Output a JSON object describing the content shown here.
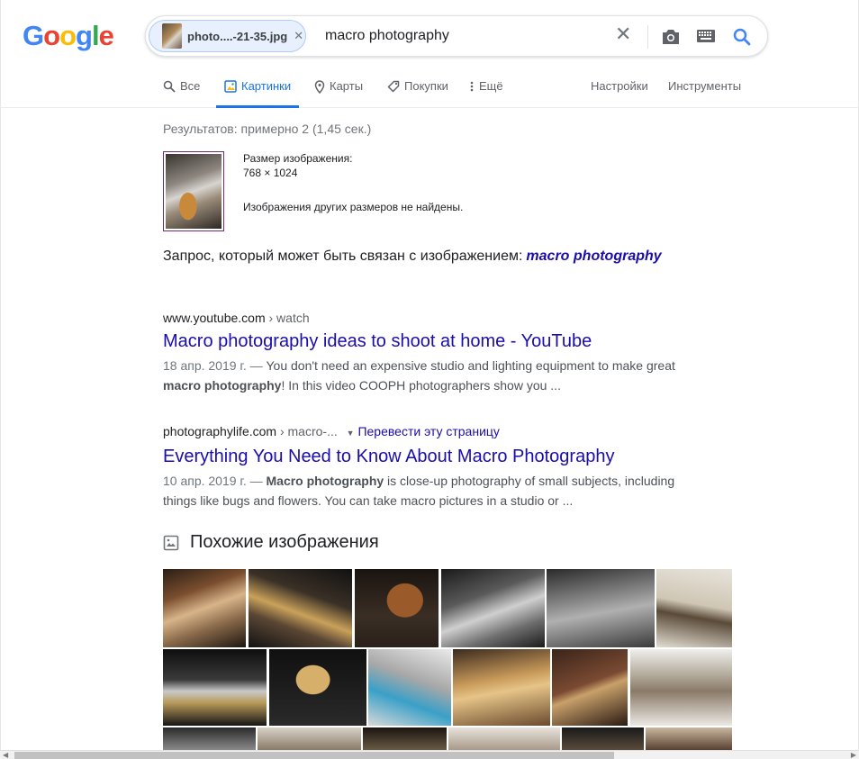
{
  "logo": "Google",
  "search": {
    "chip_name": "photo....-21-35.jpg",
    "query": "macro photography"
  },
  "tabs": [
    {
      "label": "Все",
      "icon": "search-icon"
    },
    {
      "label": "Картинки",
      "icon": "images-icon",
      "active": true
    },
    {
      "label": "Карты",
      "icon": "map-pin-icon"
    },
    {
      "label": "Покупки",
      "icon": "tag-icon"
    },
    {
      "label": "Ещё",
      "icon": "more-vertical-icon"
    }
  ],
  "tools": {
    "settings": "Настройки",
    "tools": "Инструменты"
  },
  "stats": "Результатов: примерно 2 (1,45 сек.)",
  "image_info": {
    "size_label": "Размер изображения:",
    "size_value": "768 × 1024",
    "other_sizes": "Изображения других размеров не найдены."
  },
  "related": {
    "prefix": "Запрос, который может быть связан с изображением:",
    "query": "macro photography"
  },
  "results": [
    {
      "domain": "www.youtube.com",
      "path": " › watch",
      "translate": "",
      "title": "Macro photography ideas to shoot at home - YouTube",
      "date": "18 апр. 2019 г. — ",
      "snippet_1": "You don't need an expensive studio and lighting equipment to make great ",
      "snippet_bold": "macro photography",
      "snippet_2": "! In this video COOPH photographers show you ..."
    },
    {
      "domain": "photographylife.com",
      "path": " › macro-...",
      "translate": "Перевести эту страницу",
      "title": "Everything You Need to Know About Macro Photography",
      "date": "10 апр. 2019 г. — ",
      "snippet_bold": "Macro photography",
      "snippet_2": " is close-up photography of small subjects, including things like bugs and flowers. You can take macro pictures in a studio or ..."
    }
  ],
  "similar": {
    "title": "Похожие изображения"
  },
  "colors": {
    "link": "#1a0dab",
    "accent": "#1a73e8",
    "muted": "#70757a"
  }
}
